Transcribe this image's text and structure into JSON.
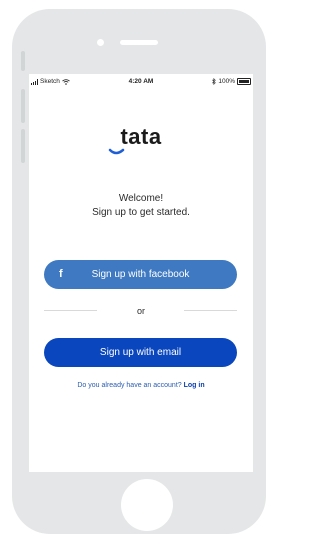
{
  "status_bar": {
    "carrier": "Sketch",
    "time": "4:20 AM",
    "battery": "100%"
  },
  "app": {
    "logo": "tata"
  },
  "welcome": {
    "line1": "Welcome!",
    "line2": "Sign up to get started."
  },
  "actions": {
    "facebook_icon": "f",
    "facebook_label": "Sign up with facebook",
    "divider_label": "or",
    "email_label": "Sign up with email"
  },
  "login": {
    "prompt": "Do you already have an account?",
    "link_label": "Log in"
  },
  "colors": {
    "facebook_button": "#3f79c1",
    "email_button": "#0a46bd",
    "link": "#0a3fae",
    "logo_accent": "#1f5fd6"
  },
  "icons": {
    "signal": "signal-bars-icon",
    "wifi": "wifi-icon",
    "bluetooth": "bluetooth-icon",
    "battery": "battery-icon",
    "facebook": "facebook-icon"
  }
}
